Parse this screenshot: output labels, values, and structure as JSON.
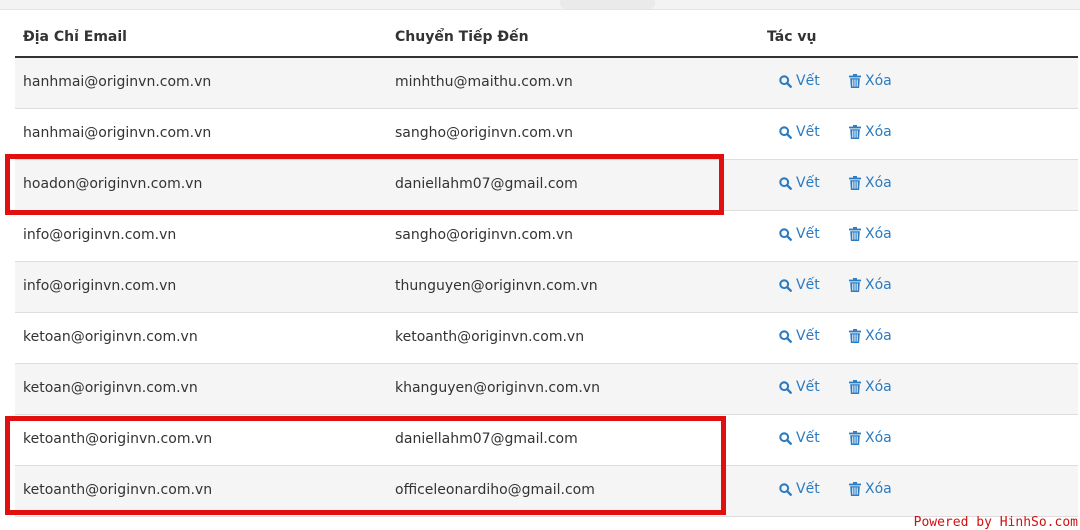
{
  "table": {
    "headers": [
      "Địa Chỉ Email",
      "Chuyển Tiếp Đến",
      "Tác vụ"
    ],
    "action_labels": {
      "trace": "Vết",
      "delete": "Xóa"
    },
    "rows": [
      {
        "email": "hanhmai@originvn.com.vn",
        "forward_to": "minhthu@maithu.com.vn"
      },
      {
        "email": "hanhmai@originvn.com.vn",
        "forward_to": "sangho@originvn.com.vn"
      },
      {
        "email": "hoadon@originvn.com.vn",
        "forward_to": "daniellahm07@gmail.com"
      },
      {
        "email": "info@originvn.com.vn",
        "forward_to": "sangho@originvn.com.vn"
      },
      {
        "email": "info@originvn.com.vn",
        "forward_to": "thunguyen@originvn.com.vn"
      },
      {
        "email": "ketoan@originvn.com.vn",
        "forward_to": "ketoanth@originvn.com.vn"
      },
      {
        "email": "ketoan@originvn.com.vn",
        "forward_to": "khanguyen@originvn.com.vn"
      },
      {
        "email": "ketoanth@originvn.com.vn",
        "forward_to": "daniellahm07@gmail.com"
      },
      {
        "email": "ketoanth@originvn.com.vn",
        "forward_to": "officeleonardiho@gmail.com"
      }
    ]
  },
  "icons": {
    "trace": "search-icon",
    "delete": "trash-icon"
  },
  "colors": {
    "action": "#2a7bc2",
    "highlight": "#e01010",
    "header_rule": "#333333"
  },
  "watermark": "Powered by HinhSo.com"
}
